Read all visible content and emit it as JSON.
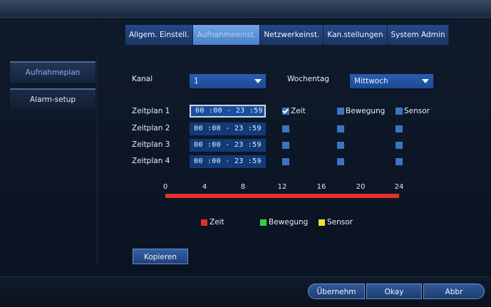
{
  "tabs": [
    {
      "label": "Allgem. Einstell."
    },
    {
      "label": "Aufnahmeeinst."
    },
    {
      "label": "Netzwerkeinst."
    },
    {
      "label": "Kan.stellungen"
    },
    {
      "label": "System Admin"
    }
  ],
  "sidebar": {
    "items": [
      {
        "label": "Aufnahmeplan"
      },
      {
        "label": "Alarm-setup"
      }
    ]
  },
  "form": {
    "kanal_label": "Kanal",
    "kanal_value": "1",
    "wochentag_label": "Wochentag",
    "wochentag_value": "Mittwoch"
  },
  "schedules": [
    {
      "label": "Zeitplan 1",
      "time": "00 :00  -  23 :59"
    },
    {
      "label": "Zeitplan 2",
      "time": "00 :00  -  23 :59"
    },
    {
      "label": "Zeitplan 3",
      "time": "00 :00  -  23 :59"
    },
    {
      "label": "Zeitplan 4",
      "time": "00 :00  -  23 :59"
    }
  ],
  "columns": {
    "zeit": "Zeit",
    "bewegung": "Bewegung",
    "sensor": "Sensor"
  },
  "timeline_ticks": [
    "0",
    "4",
    "8",
    "12",
    "16",
    "20",
    "24"
  ],
  "legend": {
    "zeit": "Zeit",
    "bewegung": "Bewegung",
    "sensor": "Sensor"
  },
  "colors": {
    "zeit": "#e0322a",
    "bewegung": "#2fd34a",
    "sensor": "#f0e02a"
  },
  "buttons": {
    "copy": "Kopieren",
    "apply": "Übernehm",
    "ok": "Okay",
    "cancel": "Abbr"
  }
}
